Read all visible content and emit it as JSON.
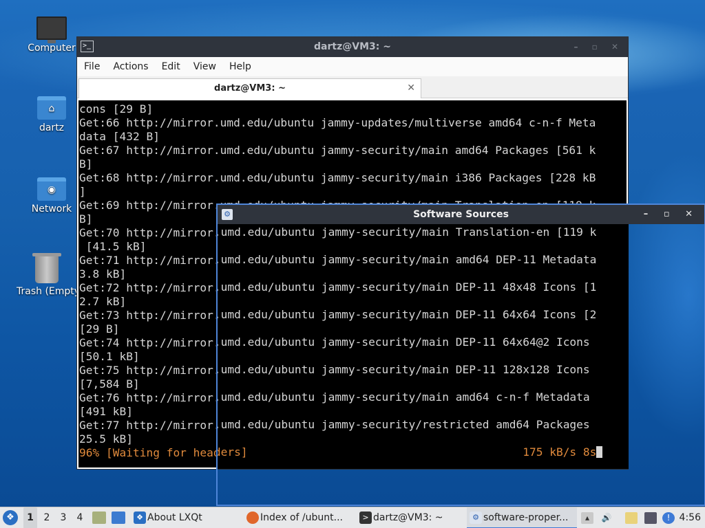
{
  "desktop": {
    "icons": [
      {
        "label": "Computer"
      },
      {
        "label": "dartz"
      },
      {
        "label": "Network"
      },
      {
        "label": "Trash (Empty)"
      }
    ]
  },
  "terminal": {
    "title": "dartz@VM3: ~",
    "menu": [
      "File",
      "Actions",
      "Edit",
      "View",
      "Help"
    ],
    "tab_label": "dartz@VM3: ~",
    "lines": [
      "cons [29 B]",
      "Get:66 http://mirror.umd.edu/ubuntu jammy-updates/multiverse amd64 c-n-f Meta",
      "data [432 B]",
      "Get:67 http://mirror.umd.edu/ubuntu jammy-security/main amd64 Packages [561 k",
      "B]",
      "Get:68 http://mirror.umd.edu/ubuntu jammy-security/main i386 Packages [228 kB",
      "]",
      "Get:69 http://mirror.umd.edu/ubuntu jammy-security/main Translation-en [119 k",
      "B]",
      "Get:70 http://mirror.umd.edu/ubuntu jammy-security/main Translation-en [119 k",
      " [41.5 kB]",
      "Get:71 http://mirror.umd.edu/ubuntu jammy-security/main amd64 DEP-11 Metadata",
      "3.8 kB]",
      "Get:72 http://mirror.umd.edu/ubuntu jammy-security/main DEP-11 48x48 Icons [1",
      "2.7 kB]",
      "Get:73 http://mirror.umd.edu/ubuntu jammy-security/main DEP-11 64x64 Icons [2",
      "[29 B]",
      "Get:74 http://mirror.umd.edu/ubuntu jammy-security/main DEP-11 64x64@2 Icons",
      "[50.1 kB]",
      "Get:75 http://mirror.umd.edu/ubuntu jammy-security/main DEP-11 128x128 Icons",
      "[7,584 B]",
      "Get:76 http://mirror.umd.edu/ubuntu jammy-security/main amd64 c-n-f Metadata",
      "[491 kB]",
      "Get:77 http://mirror.umd.edu/ubuntu jammy-security/restricted amd64 Packages",
      "25.5 kB]"
    ],
    "progress_left": "96% [Waiting for headers]",
    "progress_right": "175 kB/s 8s"
  },
  "software_sources": {
    "title": "Software Sources"
  },
  "taskbar": {
    "workspaces": [
      "1",
      "2",
      "3",
      "4"
    ],
    "tasks": [
      {
        "label": "About LXQt"
      },
      {
        "label": "Index of /ubunt..."
      },
      {
        "label": "dartz@VM3: ~"
      },
      {
        "label": "software-proper..."
      }
    ],
    "clock": "4:56"
  },
  "colors": {
    "accent": "#4f86d9",
    "progress_text": "#e08a3c",
    "titlebar": "#2f343d"
  }
}
